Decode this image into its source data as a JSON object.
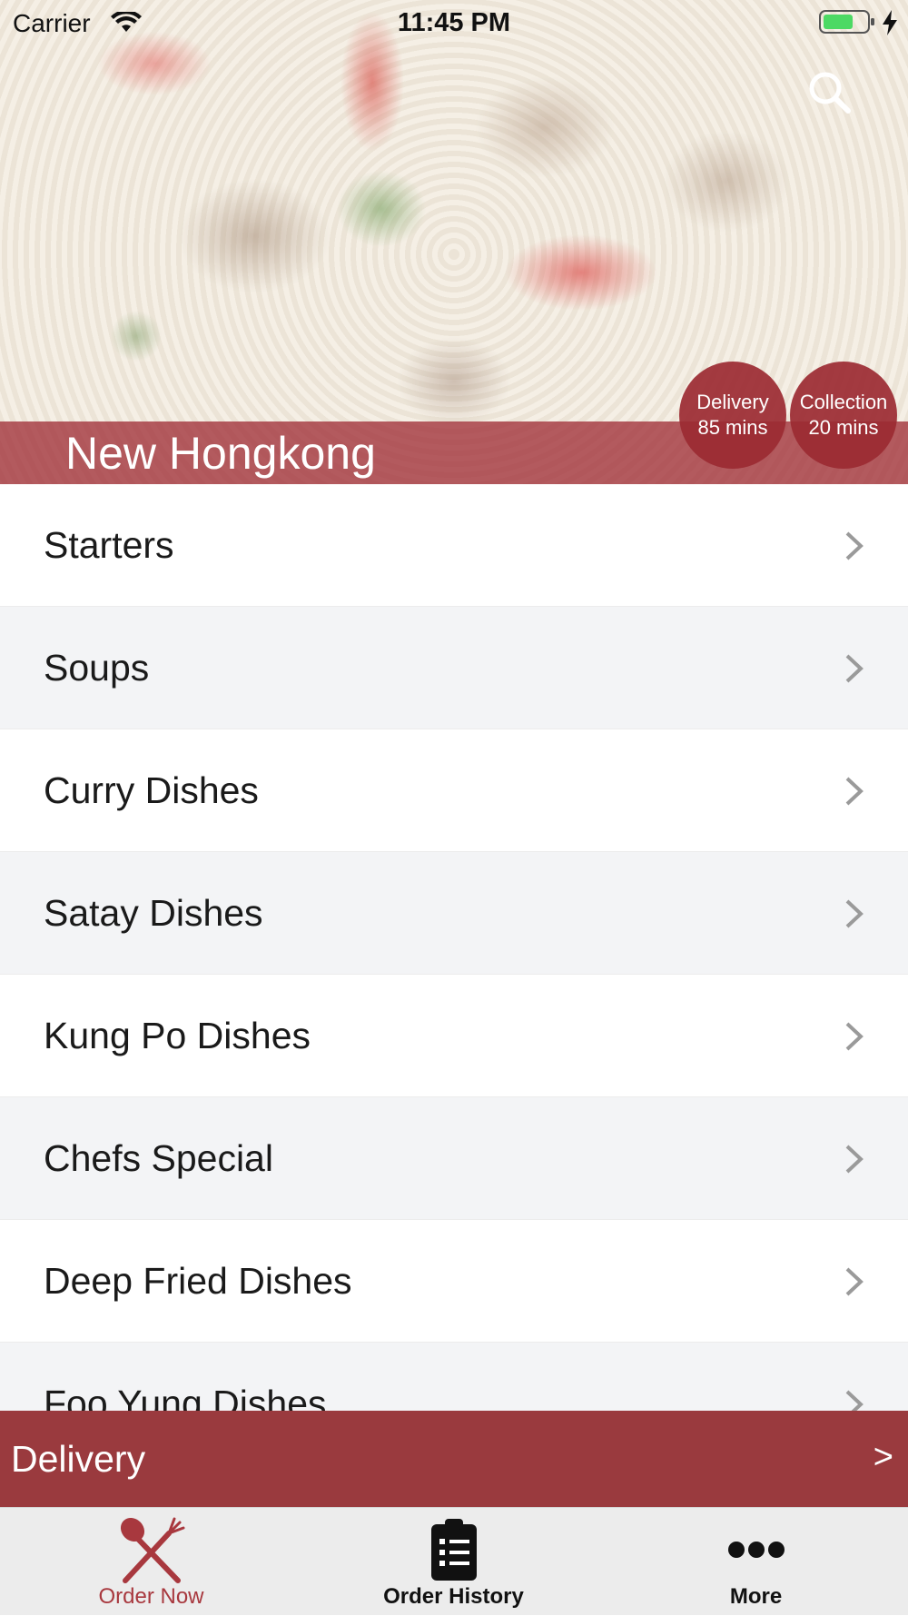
{
  "status_bar": {
    "carrier": "Carrier",
    "time": "11:45 PM"
  },
  "hero": {
    "restaurant_name": "New Hongkong",
    "delivery_badge": {
      "label": "Delivery",
      "time": "85 mins"
    },
    "collection_badge": {
      "label": "Collection",
      "time": "20 mins"
    }
  },
  "menu": {
    "items": [
      {
        "label": "Starters"
      },
      {
        "label": "Soups"
      },
      {
        "label": "Curry Dishes"
      },
      {
        "label": "Satay Dishes"
      },
      {
        "label": "Kung Po Dishes"
      },
      {
        "label": "Chefs Special"
      },
      {
        "label": "Deep Fried Dishes"
      },
      {
        "label": "Foo Yung Dishes"
      }
    ]
  },
  "delivery_bar": {
    "label": "Delivery",
    "arrow": ">"
  },
  "tabs": [
    {
      "label": "Order Now",
      "icon": "fork-knife-icon",
      "active": true
    },
    {
      "label": "Order History",
      "icon": "clipboard-icon",
      "active": false
    },
    {
      "label": "More",
      "icon": "more-dots-icon",
      "active": false
    }
  ],
  "colors": {
    "accent": "#9a3a3e",
    "active_tab": "#a8383e",
    "battery_fill": "#4cd964"
  }
}
